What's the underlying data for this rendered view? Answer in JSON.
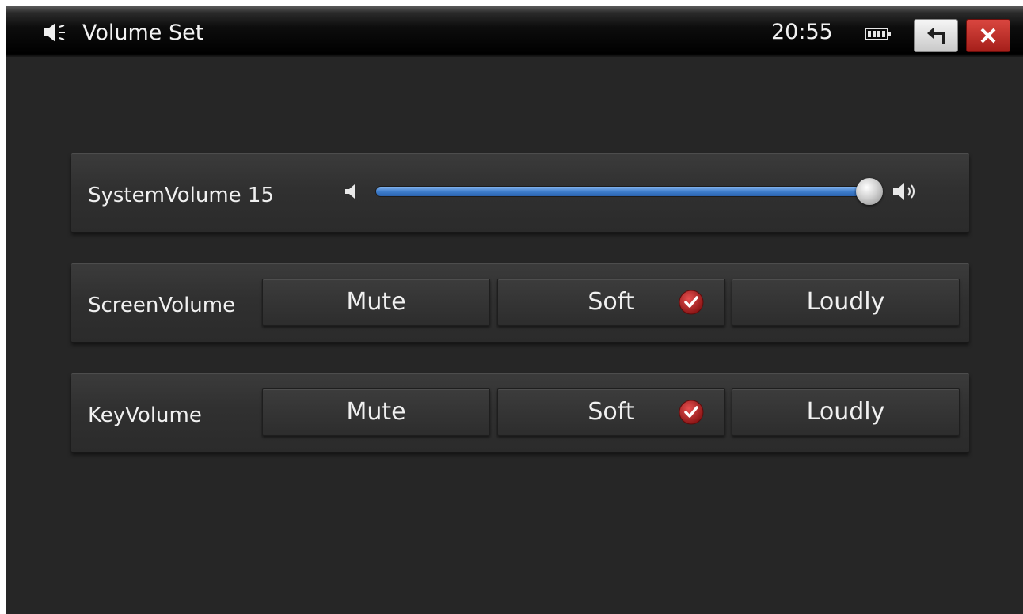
{
  "titlebar": {
    "title": "Volume Set",
    "time": "20:55",
    "icons": {
      "title": "speaker-icon",
      "battery": "battery-icon",
      "back": "back-arrow-icon",
      "close": "close-icon"
    }
  },
  "system_volume": {
    "label": "SystemVolume 15",
    "level": 15,
    "level_fraction": 1.0,
    "icons": {
      "low": "speaker-low-icon",
      "high": "speaker-high-icon"
    }
  },
  "screen_volume": {
    "label": "ScreenVolume",
    "options": [
      "Mute",
      "Soft",
      "Loudly"
    ],
    "selected": "Soft"
  },
  "key_volume": {
    "label": "KeyVolume",
    "options": [
      "Mute",
      "Soft",
      "Loudly"
    ],
    "selected": "Soft"
  },
  "colors": {
    "background": "#262626",
    "slider": "#3d7ccb",
    "check": "#b52424",
    "close_button": "#c0312b"
  }
}
